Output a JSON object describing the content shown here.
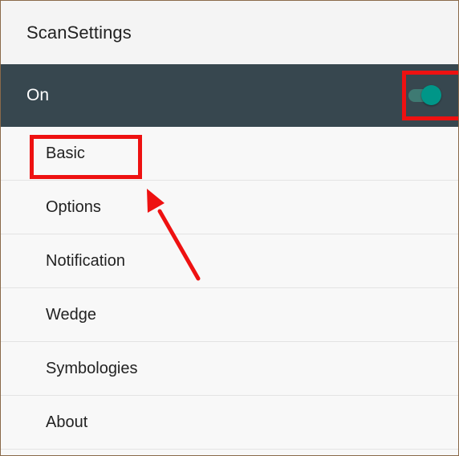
{
  "app_bar": {
    "title": "ScanSettings"
  },
  "master_switch": {
    "label": "On",
    "state": "on"
  },
  "menu": {
    "items": [
      {
        "label": "Basic"
      },
      {
        "label": "Options"
      },
      {
        "label": "Notification"
      },
      {
        "label": "Wedge"
      },
      {
        "label": "Symbologies"
      },
      {
        "label": "About"
      }
    ]
  },
  "colors": {
    "master_bar": "#37474f",
    "switch_thumb": "#009688",
    "annotation": "#ee1111"
  }
}
